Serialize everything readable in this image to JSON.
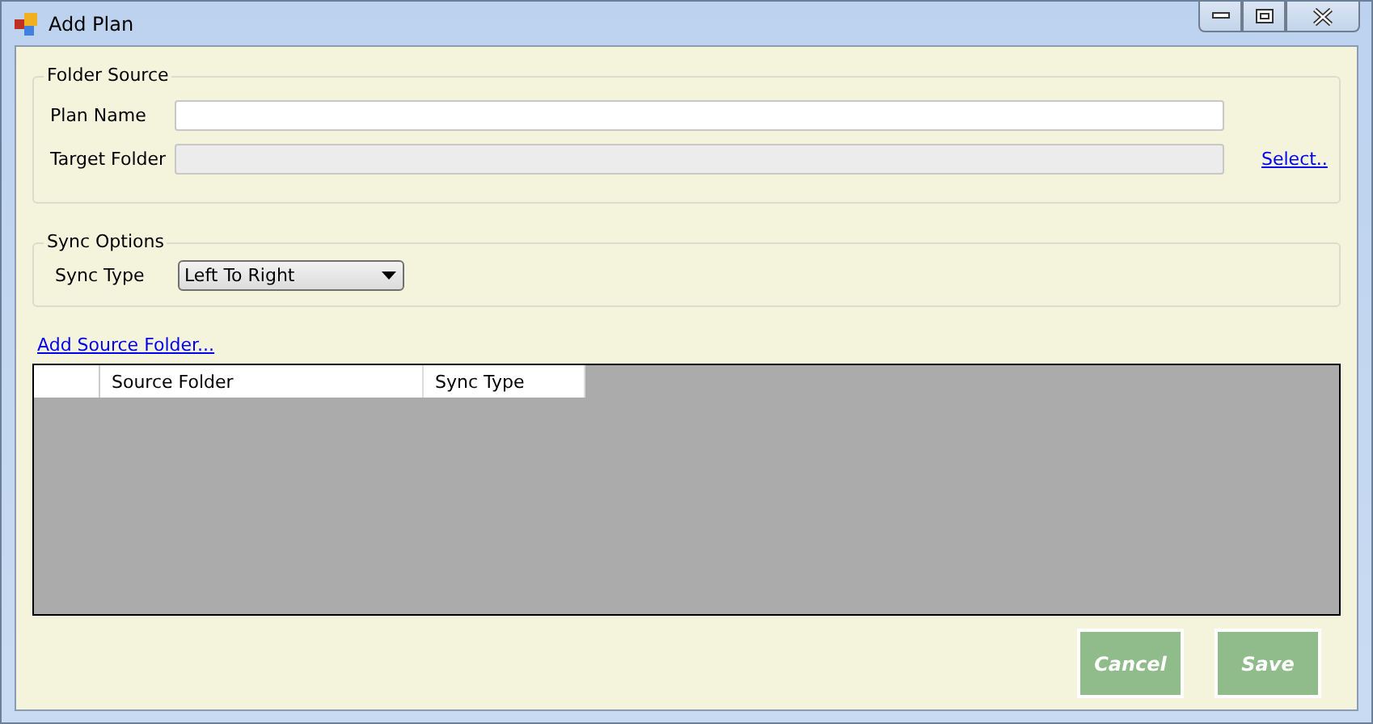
{
  "window": {
    "title": "Add Plan"
  },
  "folder_source": {
    "title": "Folder Source",
    "plan_name": {
      "label": "Plan Name",
      "disabled": false
    },
    "target_folder": {
      "label": "Target Folder",
      "disabled": true
    },
    "select_link": "Select.."
  },
  "sync_options": {
    "title": "Sync Options",
    "sync_type": {
      "label": "Sync Type",
      "value": "Left To Right"
    }
  },
  "add_source_link": "Add Source Folder...",
  "table": {
    "columns": [
      "Source Folder",
      "Sync Type"
    ]
  },
  "buttons": [
    "Cancel",
    "Save"
  ]
}
